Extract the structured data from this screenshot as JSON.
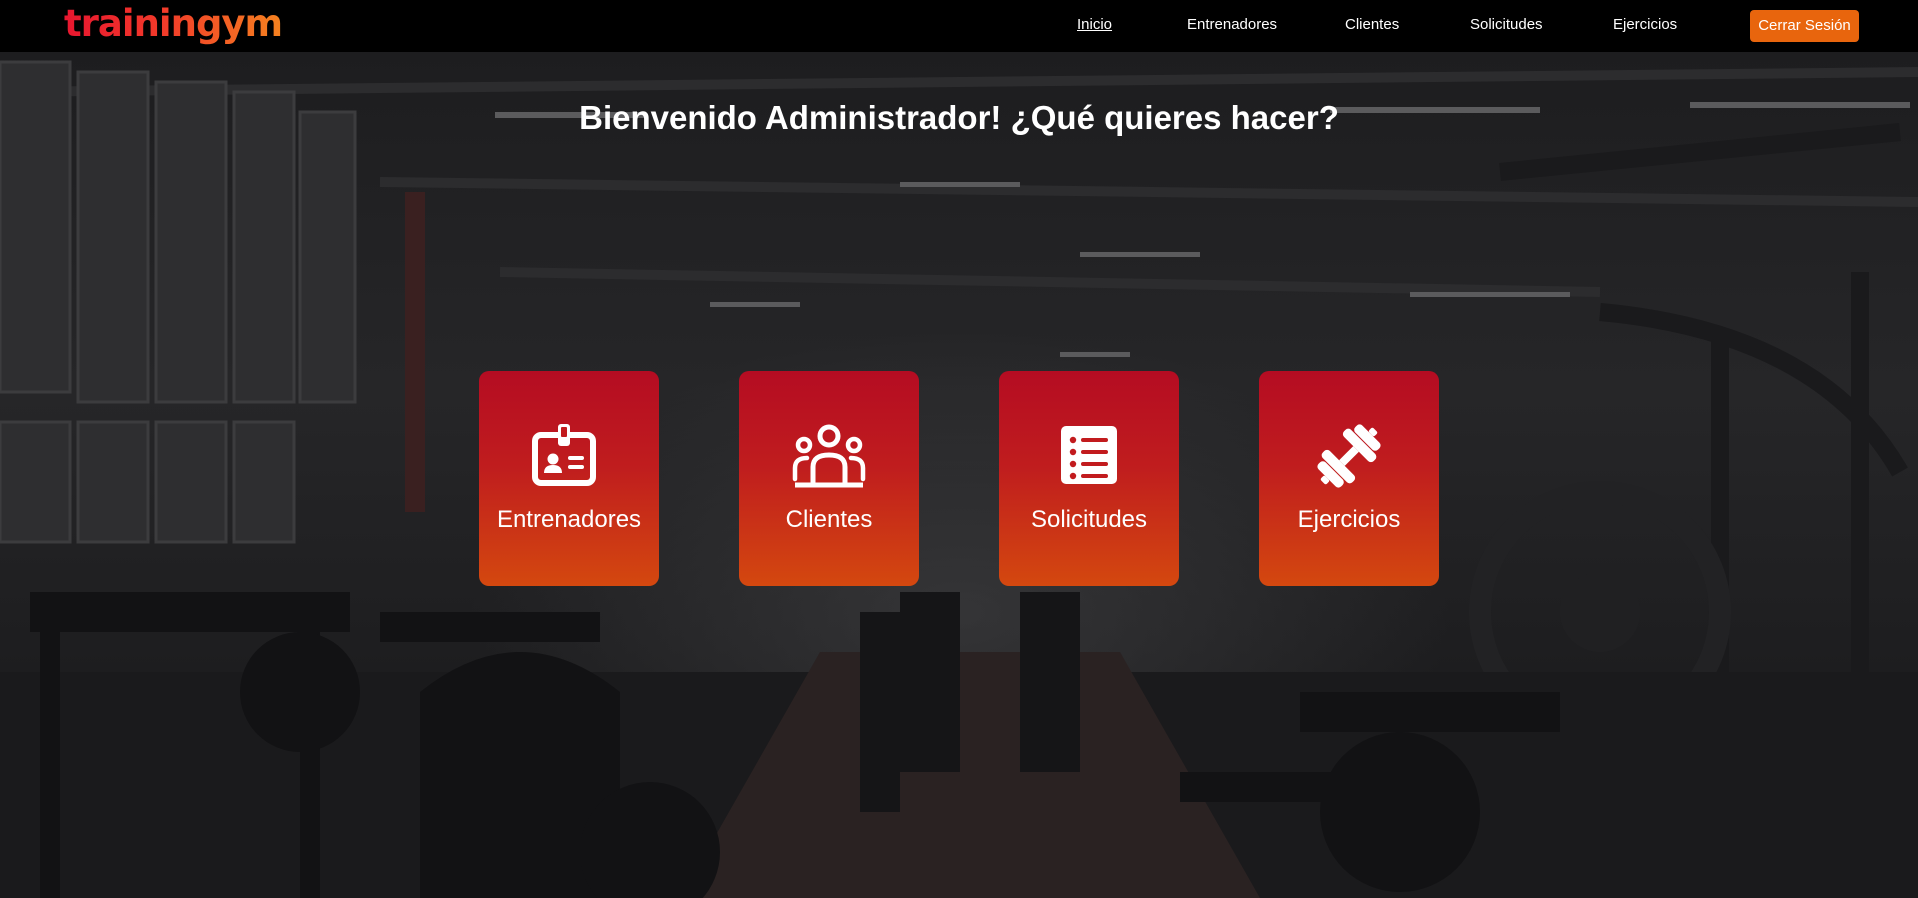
{
  "brand": {
    "logo_text": "trainingym"
  },
  "nav": {
    "items": [
      {
        "label": "Inicio",
        "active": true
      },
      {
        "label": "Entrenadores",
        "active": false
      },
      {
        "label": "Clientes",
        "active": false
      },
      {
        "label": "Solicitudes",
        "active": false
      },
      {
        "label": "Ejercicios",
        "active": false
      }
    ],
    "logout_label": "Cerrar Sesión"
  },
  "main": {
    "welcome": "Bienvenido Administrador! ¿Qué quieres hacer?",
    "cards": [
      {
        "label": "Entrenadores",
        "icon": "id-badge-icon"
      },
      {
        "label": "Clientes",
        "icon": "users-group-icon"
      },
      {
        "label": "Solicitudes",
        "icon": "list-document-icon"
      },
      {
        "label": "Ejercicios",
        "icon": "dumbbell-icon"
      }
    ]
  },
  "colors": {
    "navbar_bg": "#000000",
    "accent_orange": "#e8650d",
    "logo_red": "#e8162f",
    "card_top": "#b50c22",
    "card_bottom": "#d4480f",
    "text": "#ffffff"
  }
}
